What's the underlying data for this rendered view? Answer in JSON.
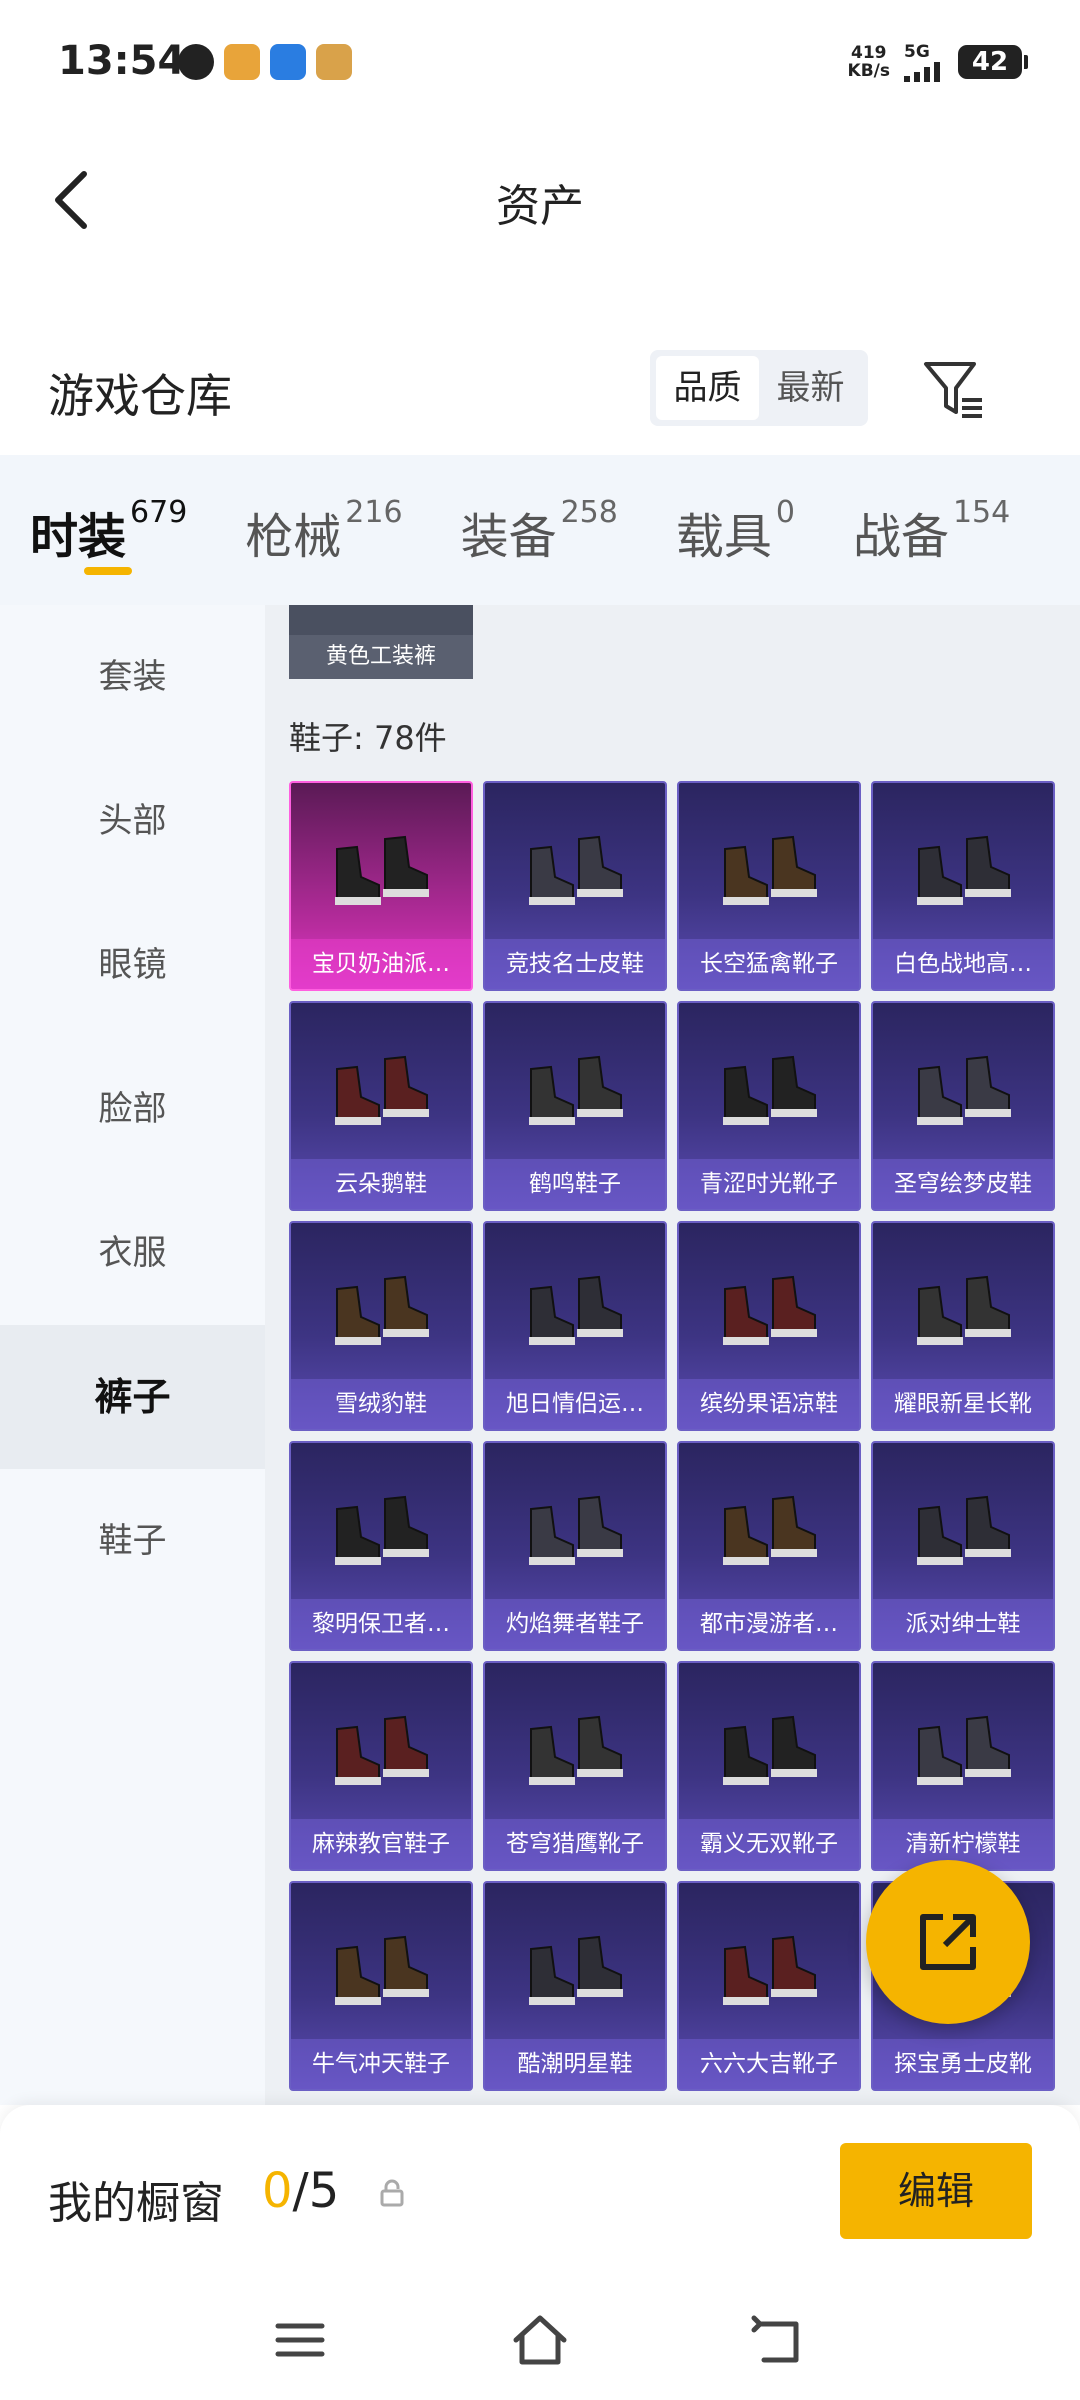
{
  "status_bar": {
    "time": "13:54",
    "net_speed_value": "419",
    "net_speed_unit": "KB/s",
    "network": "5G",
    "battery": "42"
  },
  "header": {
    "title": "资产"
  },
  "section": {
    "title": "游戏仓库",
    "sort_options": [
      "品质",
      "最新"
    ],
    "active_sort": "品质"
  },
  "category_tabs": [
    {
      "label": "时装",
      "count": "679",
      "active": true
    },
    {
      "label": "枪械",
      "count": "216",
      "active": false
    },
    {
      "label": "装备",
      "count": "258",
      "active": false
    },
    {
      "label": "载具",
      "count": "0",
      "active": false
    },
    {
      "label": "战备",
      "count": "154",
      "active": false
    }
  ],
  "side_menu": [
    {
      "label": "套装",
      "active": false
    },
    {
      "label": "头部",
      "active": false
    },
    {
      "label": "眼镜",
      "active": false
    },
    {
      "label": "脸部",
      "active": false
    },
    {
      "label": "衣服",
      "active": false
    },
    {
      "label": "裤子",
      "active": true
    },
    {
      "label": "鞋子",
      "active": false
    }
  ],
  "peek_item": "黄色工装裤",
  "group_title": "鞋子: 78件",
  "items": [
    {
      "name": "宝贝奶油派…",
      "special": true
    },
    {
      "name": "竞技名士皮鞋"
    },
    {
      "name": "长空猛禽靴子"
    },
    {
      "name": "白色战地高…"
    },
    {
      "name": "云朵鹅鞋"
    },
    {
      "name": "鹤鸣鞋子"
    },
    {
      "name": "青涩时光靴子"
    },
    {
      "name": "圣穹绘梦皮鞋"
    },
    {
      "name": "雪绒豹鞋"
    },
    {
      "name": "旭日情侣运…"
    },
    {
      "name": "缤纷果语凉鞋"
    },
    {
      "name": "耀眼新星长靴"
    },
    {
      "name": "黎明保卫者…"
    },
    {
      "name": "灼焰舞者鞋子"
    },
    {
      "name": "都市漫游者…"
    },
    {
      "name": "派对绅士鞋"
    },
    {
      "name": "麻辣教官鞋子"
    },
    {
      "name": "苍穹猎鹰靴子"
    },
    {
      "name": "霸义无双靴子"
    },
    {
      "name": "清新柠檬鞋"
    },
    {
      "name": "牛气冲天鞋子"
    },
    {
      "name": "酷潮明星鞋"
    },
    {
      "name": "六六大吉靴子"
    },
    {
      "name": "探宝勇士皮靴"
    }
  ],
  "showcase": {
    "label": "我的橱窗",
    "current": "0",
    "total": "/5",
    "edit_label": "编辑"
  },
  "colors": {
    "accent": "#f5b400",
    "card_bg": "#3d3483",
    "special_card_bg": "#b82c9e"
  }
}
